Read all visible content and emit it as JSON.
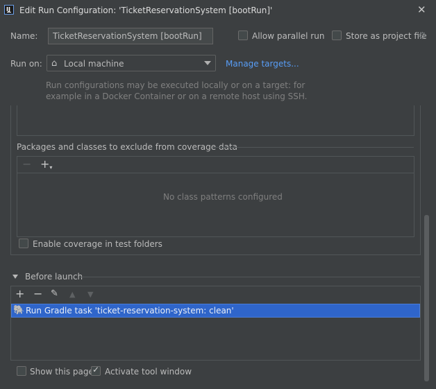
{
  "window": {
    "title": "Edit Run Configuration: 'TicketReservationSystem [bootRun]'",
    "app_icon": "intellij-icon"
  },
  "form": {
    "name_label": "Name:",
    "name_value": "TicketReservationSystem [bootRun]",
    "allow_parallel_label": "Allow parallel run",
    "allow_parallel_checked": false,
    "store_project_label": "Store as project file",
    "store_project_checked": false,
    "run_on_label": "Run on:",
    "run_on_value": "Local machine",
    "manage_targets_label": "Manage targets...",
    "run_on_hint_line1": "Run configurations may be executed locally or on a target: for",
    "run_on_hint_line2": "example in a Docker Container or on a remote host using SSH."
  },
  "coverage": {
    "exclude_header": "Packages and classes to exclude from coverage data",
    "empty_text": "No class patterns configured",
    "enable_test_folders_label": "Enable coverage in test folders",
    "enable_test_folders_checked": false
  },
  "before_launch": {
    "header": "Before launch",
    "tasks": [
      {
        "label": "Run Gradle task 'ticket-reservation-system: clean'",
        "icon": "gradle-elephant-icon",
        "selected": true
      }
    ]
  },
  "footer": {
    "show_page_label": "Show this page",
    "show_page_checked": false,
    "activate_tool_window_label": "Activate tool window",
    "activate_tool_window_checked": true
  },
  "colors": {
    "background": "#3c3f41",
    "selection": "#2f65ca",
    "link": "#589df6",
    "border": "#515658"
  }
}
